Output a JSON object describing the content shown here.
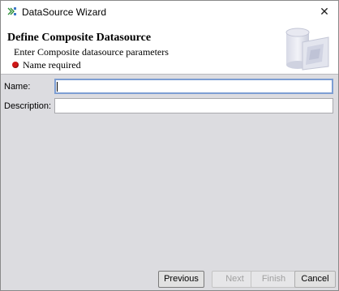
{
  "window": {
    "title": "DataSource Wizard",
    "close_glyph": "✕",
    "icon": "wizard-app-icon"
  },
  "header": {
    "title": "Define Composite Datasource",
    "subtitle": "Enter Composite datasource parameters",
    "error_message": "Name required",
    "error_color": "#d01818",
    "banner_icon": "datasource-cylinder-icon"
  },
  "form": {
    "name_label": "Name:",
    "name_value": "",
    "description_label": "Description:",
    "description_value": ""
  },
  "buttons": {
    "previous": "Previous",
    "next": "Next",
    "finish": "Finish",
    "cancel": "Cancel",
    "next_enabled": false,
    "finish_enabled": false
  }
}
